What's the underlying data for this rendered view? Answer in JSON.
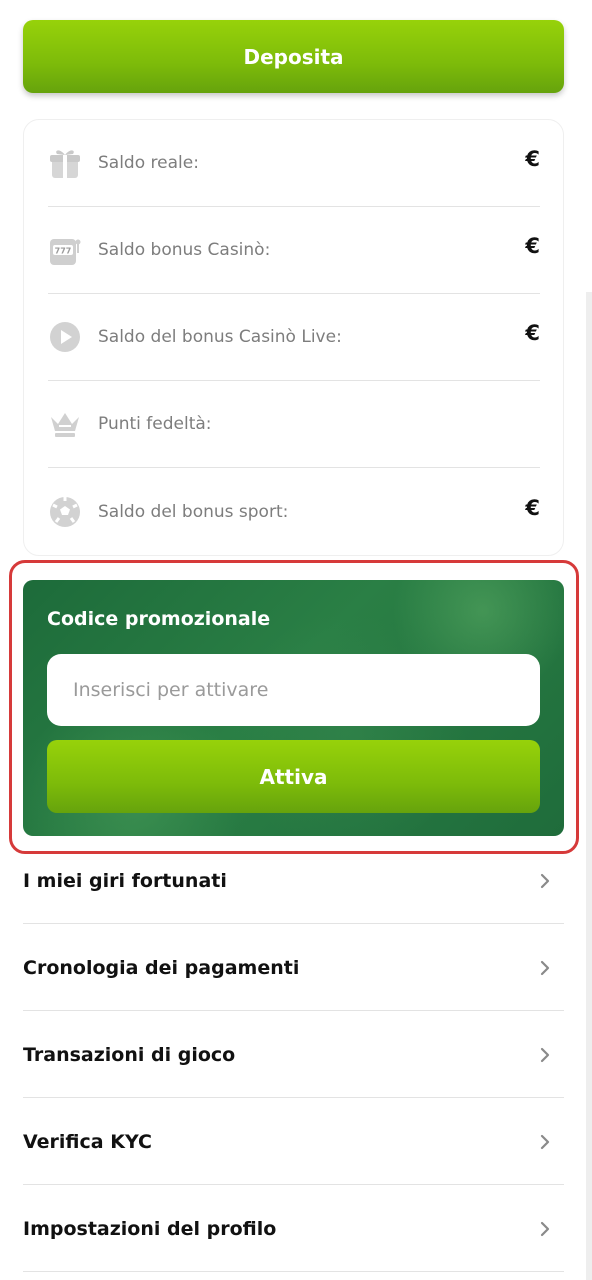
{
  "deposit": {
    "label": "Deposita"
  },
  "balances": [
    {
      "icon": "gift-icon",
      "label": "Saldo reale:",
      "value": "€"
    },
    {
      "icon": "slot-machine-icon",
      "label": "Saldo bonus Casinò:",
      "value": "€"
    },
    {
      "icon": "play-icon",
      "label": "Saldo del bonus Casinò Live:",
      "value": "€"
    },
    {
      "icon": "crown-icon",
      "label": "Punti fedeltà:",
      "value": ""
    },
    {
      "icon": "soccer-ball-icon",
      "label": "Saldo del bonus sport:",
      "value": "€"
    }
  ],
  "promo": {
    "title": "Codice promozionale",
    "input_placeholder": "Inserisci per attivare",
    "input_value": "",
    "button_label": "Attiva"
  },
  "menu": [
    {
      "label": "I miei giri fortunati",
      "icon": "chevron-right-icon"
    },
    {
      "label": "Cronologia dei pagamenti",
      "icon": "chevron-right-icon"
    },
    {
      "label": "Transazioni di gioco",
      "icon": "chevron-right-icon"
    },
    {
      "label": "Verifica KYC",
      "icon": "chevron-right-icon"
    },
    {
      "label": "Impostazioni del profilo",
      "icon": "chevron-right-icon"
    }
  ],
  "colors": {
    "accent_green": "#7dbb0a",
    "promo_bg": "#1d6b3a",
    "highlight_outline": "#d63a3a"
  }
}
